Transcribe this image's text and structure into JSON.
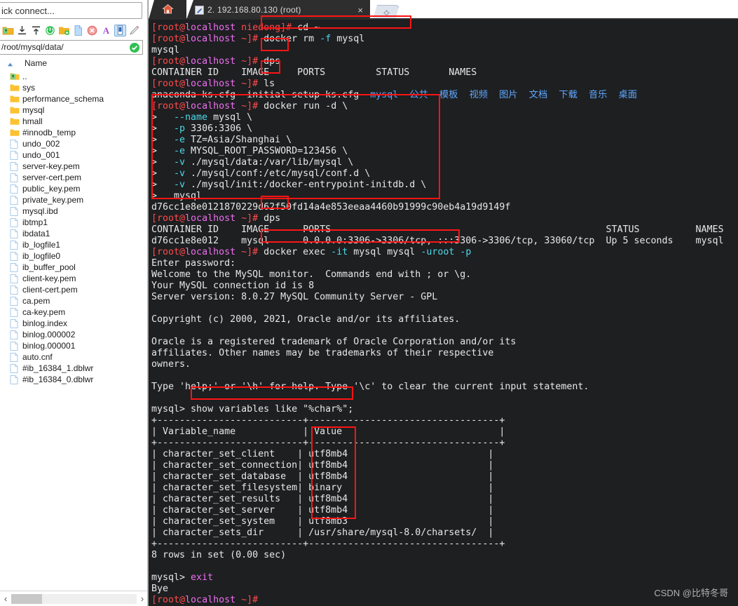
{
  "sidebar": {
    "quick_connect": {
      "value": "ick connect...",
      "placeholder": "Quick connect..."
    },
    "toolbar_icons": [
      {
        "name": "parent-folder-icon",
        "glyph": "folder-up"
      },
      {
        "name": "download-icon",
        "glyph": "arrow-down-bar"
      },
      {
        "name": "upload-icon",
        "glyph": "arrow-up-bar"
      },
      {
        "name": "refresh-icon",
        "glyph": "refresh"
      },
      {
        "name": "new-folder-icon",
        "glyph": "folder-plus"
      },
      {
        "name": "new-file-icon",
        "glyph": "file"
      },
      {
        "name": "delete-icon",
        "glyph": "delete-x"
      },
      {
        "name": "rename-icon",
        "glyph": "letter-a"
      },
      {
        "name": "properties-icon",
        "glyph": "properties"
      },
      {
        "name": "edit-icon",
        "glyph": "pencil"
      }
    ],
    "path": {
      "value": "/root/mysql/data/",
      "status_icon": "check-circle-icon"
    },
    "column_header": "Name",
    "files": [
      {
        "name": "..",
        "type": "parent"
      },
      {
        "name": "sys",
        "type": "folder"
      },
      {
        "name": "performance_schema",
        "type": "folder"
      },
      {
        "name": "mysql",
        "type": "folder"
      },
      {
        "name": "hmall",
        "type": "folder"
      },
      {
        "name": "#innodb_temp",
        "type": "folder"
      },
      {
        "name": "undo_002",
        "type": "file"
      },
      {
        "name": "undo_001",
        "type": "file"
      },
      {
        "name": "server-key.pem",
        "type": "file"
      },
      {
        "name": "server-cert.pem",
        "type": "file"
      },
      {
        "name": "public_key.pem",
        "type": "file"
      },
      {
        "name": "private_key.pem",
        "type": "file"
      },
      {
        "name": "mysql.ibd",
        "type": "file"
      },
      {
        "name": "ibtmp1",
        "type": "file"
      },
      {
        "name": "ibdata1",
        "type": "file"
      },
      {
        "name": "ib_logfile1",
        "type": "file"
      },
      {
        "name": "ib_logfile0",
        "type": "file"
      },
      {
        "name": "ib_buffer_pool",
        "type": "file"
      },
      {
        "name": "client-key.pem",
        "type": "file"
      },
      {
        "name": "client-cert.pem",
        "type": "file"
      },
      {
        "name": "ca.pem",
        "type": "file"
      },
      {
        "name": "ca-key.pem",
        "type": "file"
      },
      {
        "name": "binlog.index",
        "type": "file"
      },
      {
        "name": "binlog.000002",
        "type": "file"
      },
      {
        "name": "binlog.000001",
        "type": "file"
      },
      {
        "name": "auto.cnf",
        "type": "file"
      },
      {
        "name": "#ib_16384_1.dblwr",
        "type": "file"
      },
      {
        "name": "#ib_16384_0.dblwr",
        "type": "file"
      }
    ],
    "hscroll": {
      "left_arrow": "‹",
      "right_arrow": "›"
    }
  },
  "terminal": {
    "tabs": {
      "home_icon": "home-icon",
      "active_label": "2. 192.168.80.130 (root)",
      "close_label": "×",
      "new_tab_icon": "new-tab-icon"
    },
    "prompt": {
      "bracket_user": "[root@",
      "host": "localhost",
      "dir_niedong": " niedong]# ",
      "dir_home": " ~]# "
    },
    "lines": {
      "l01_cmd": "cd ~",
      "l02_cmd": "docker rm -f mysql",
      "l03": "mysql",
      "l04_cmd": "dps",
      "l05": "CONTAINER ID    IMAGE     PORTS         STATUS       NAMES",
      "l06_cmd": "ls",
      "l07_a": "anaconda-ks.cfg  initial-setup-ks.cfg  ",
      "l07_b": "mysql",
      "l07_c": "  公共  模板  视频  图片  文档  下载  音乐  桌面",
      "run_cmd": "docker run -d \\",
      "run_l1_flag": "--name",
      "run_l1_rest": " mysql \\",
      "run_l2_flag": "-p",
      "run_l2_rest": " 3306:3306 \\",
      "run_l3_flag": "-e",
      "run_l3_rest": " TZ=Asia/Shanghai \\",
      "run_l4_flag": "-e",
      "run_l4_rest": " MYSQL_ROOT_PASSWORD=123456 \\",
      "run_l5_flag": "-v",
      "run_l5_rest": " ./mysql/data:/var/lib/mysql \\",
      "run_l6_flag": "-v",
      "run_l6_rest": " ./mysql/conf:/etc/mysql/conf.d \\",
      "run_l7_flag": "-v",
      "run_l7_rest": " ./mysql/init:/docker-entrypoint-initdb.d \\",
      "run_l8": "mysql",
      "container_hash": "d76cc1e8e0121870229d62f50fd14a4e853eeaa4460b91999c90eb4a19d9149f",
      "dps2_cmd": "dps",
      "dps2_header": "CONTAINER ID    IMAGE      PORTS                                                 STATUS          NAMES",
      "dps2_row": "d76cc1e8e012    mysql      0.0.0.0:3306->3306/tcp, :::3306->3306/tcp, 33060/tcp  Up 5 seconds    mysql",
      "exec_pre": "docker exec ",
      "exec_it": "-it",
      "exec_mid": " mysql mysql ",
      "exec_uroot": "-uroot",
      "exec_p": " -p",
      "enter_password": "Enter password:",
      "welcome": "Welcome to the MySQL monitor.  Commands end with ; or \\g.",
      "conn_id": "Your MySQL connection id is 8",
      "server_version": "Server version: 8.0.27 MySQL Community Server - GPL",
      "copyright": "Copyright (c) 2000, 2021, Oracle and/or its affiliates.",
      "trademark1": "Oracle is a registered trademark of Oracle Corporation and/or its",
      "trademark2": "affiliates. Other names may be trademarks of their respective",
      "trademark3": "owners.",
      "help": "Type 'help;' or '\\h' for help. Type '\\c' to clear the current input statement.",
      "mysql_prompt": "mysql> ",
      "sql_query": "show variables like \"%char%\";",
      "tbl_sep": "+--------------------------+----------------------------------+",
      "tbl_head": "| Variable_name            | Value                            |",
      "rows_count": "8 rows in set (0.00 sec)",
      "exit_cmd": "exit",
      "bye": "Bye"
    },
    "variables_table": {
      "columns": [
        "Variable_name",
        "Value"
      ],
      "rows": [
        {
          "name": "character_set_client",
          "value": "utf8mb4"
        },
        {
          "name": "character_set_connection",
          "value": "utf8mb4"
        },
        {
          "name": "character_set_database",
          "value": "utf8mb4"
        },
        {
          "name": "character_set_filesystem",
          "value": "binary"
        },
        {
          "name": "character_set_results",
          "value": "utf8mb4"
        },
        {
          "name": "character_set_server",
          "value": "utf8mb4"
        },
        {
          "name": "character_set_system",
          "value": "utf8mb3"
        },
        {
          "name": "character_sets_dir",
          "value": "/usr/share/mysql-8.0/charsets/"
        }
      ]
    }
  },
  "watermark": "CSDN @比特冬哥",
  "colors": {
    "terminal_bg": "#1d1f21",
    "prompt_red": "#ff4b4b",
    "prompt_magenta": "#f06ef0",
    "flag_cyan": "#4fd8e8",
    "dir_blue": "#5fa8ff",
    "highlight_red": "#ff1414",
    "tab_bg": "#2b2b2b"
  }
}
